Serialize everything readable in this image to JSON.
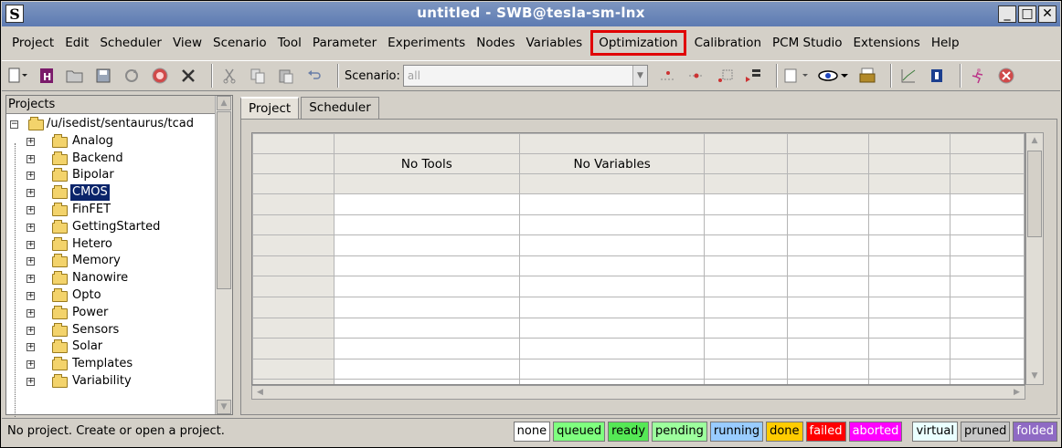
{
  "window": {
    "title": "untitled - SWB@tesla-sm-lnx",
    "logo": "S",
    "minimize": "_",
    "maximize": "□",
    "close": "✕"
  },
  "menu": [
    "Project",
    "Edit",
    "Scheduler",
    "View",
    "Scenario",
    "Tool",
    "Parameter",
    "Experiments",
    "Nodes",
    "Variables",
    "Optimization",
    "Calibration",
    "PCM Studio",
    "Extensions",
    "Help"
  ],
  "toolbar": {
    "icons": [
      "new-icon",
      "open-project-icon",
      "open-folder-icon",
      "save-icon",
      "refresh-icon",
      "stop-icon",
      "delete-icon",
      "cut-icon",
      "copy-icon",
      "paste-icon",
      "undo-icon"
    ],
    "scenario_label": "Scenario:",
    "scenario_value": "all",
    "icons_right": [
      "add-experiment-icon",
      "add-node-icon",
      "extend-icon",
      "align-icon",
      "view-menu-icon",
      "eye-icon",
      "printer-icon",
      "graph-icon",
      "book-icon",
      "run-icon",
      "abort-icon"
    ]
  },
  "projects_panel": {
    "header": "Projects",
    "root": "/u/isedist/sentaurus/tcad",
    "items": [
      "Analog",
      "Backend",
      "Bipolar",
      "CMOS",
      "FinFET",
      "GettingStarted",
      "Hetero",
      "Memory",
      "Nanowire",
      "Opto",
      "Power",
      "Sensors",
      "Solar",
      "Templates",
      "Variability"
    ],
    "selected": "CMOS"
  },
  "tabs": [
    "Project",
    "Scheduler"
  ],
  "table": {
    "no_tools": "No Tools",
    "no_variables": "No Variables"
  },
  "status": {
    "message": "No project. Create or open a project.",
    "legend": [
      {
        "label": "none",
        "color": "#ffffff",
        "text": "#000000"
      },
      {
        "label": "queued",
        "color": "#7fff7f",
        "text": "#000000"
      },
      {
        "label": "ready",
        "color": "#55e855",
        "text": "#000000"
      },
      {
        "label": "pending",
        "color": "#9dff9d",
        "text": "#000000"
      },
      {
        "label": "running",
        "color": "#99ccff",
        "text": "#000000"
      },
      {
        "label": "done",
        "color": "#ffcc00",
        "text": "#000000"
      },
      {
        "label": "failed",
        "color": "#ff0000",
        "text": "#ffffff"
      },
      {
        "label": "aborted",
        "color": "#ff00ff",
        "text": "#ffffff"
      },
      {
        "label": "virtual",
        "color": "#eaffff",
        "text": "#000000"
      },
      {
        "label": "pruned",
        "color": "#c8c8c8",
        "text": "#000000"
      },
      {
        "label": "folded",
        "color": "#8f6ac4",
        "text": "#ffffff"
      }
    ]
  }
}
